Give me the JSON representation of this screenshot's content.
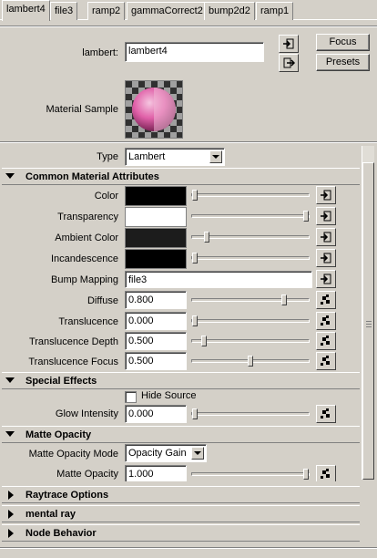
{
  "tabs": [
    "lambert4",
    "file3",
    "ramp2",
    "gammaCorrect2",
    "bump2d2",
    "ramp1"
  ],
  "header": {
    "node_label": "lambert:",
    "node_name": "lambert4",
    "focus_label": "Focus",
    "presets_label": "Presets",
    "sample_label": "Material Sample"
  },
  "type_row": {
    "label": "Type",
    "value": "Lambert"
  },
  "common": {
    "title": "Common Material Attributes",
    "color_label": "Color",
    "transparency_label": "Transparency",
    "ambient_label": "Ambient Color",
    "incandescence_label": "Incandescence",
    "bump_label": "Bump Mapping",
    "bump_value": "file3",
    "diffuse_label": "Diffuse",
    "diffuse_value": "0.800",
    "translucence_label": "Translucence",
    "translucence_value": "0.000",
    "tdepth_label": "Translucence Depth",
    "tdepth_value": "0.500",
    "tfocus_label": "Translucence Focus",
    "tfocus_value": "0.500",
    "swatch_colors": {
      "color": "#000000",
      "transparency": "#ffffff",
      "ambient": "#1c1c1c",
      "incandescence": "#000000"
    },
    "slider_levels": {
      "color": 0.0,
      "transparency": 1.0,
      "ambient": 0.11,
      "incandescence": 0.0,
      "diffuse": 0.8,
      "translucence": 0.0,
      "tdepth": 0.08,
      "tfocus": 0.5
    }
  },
  "special": {
    "title": "Special Effects",
    "hide_source_label": "Hide Source",
    "glow_label": "Glow Intensity",
    "glow_value": "0.000",
    "glow_level": 0.0
  },
  "matte": {
    "title": "Matte Opacity",
    "mode_label": "Matte Opacity Mode",
    "mode_value": "Opacity Gain",
    "opacity_label": "Matte Opacity",
    "opacity_value": "1.000",
    "opacity_level": 1.0
  },
  "collapsed_sections": [
    "Raytrace Options",
    "mental ray",
    "Node Behavior"
  ]
}
